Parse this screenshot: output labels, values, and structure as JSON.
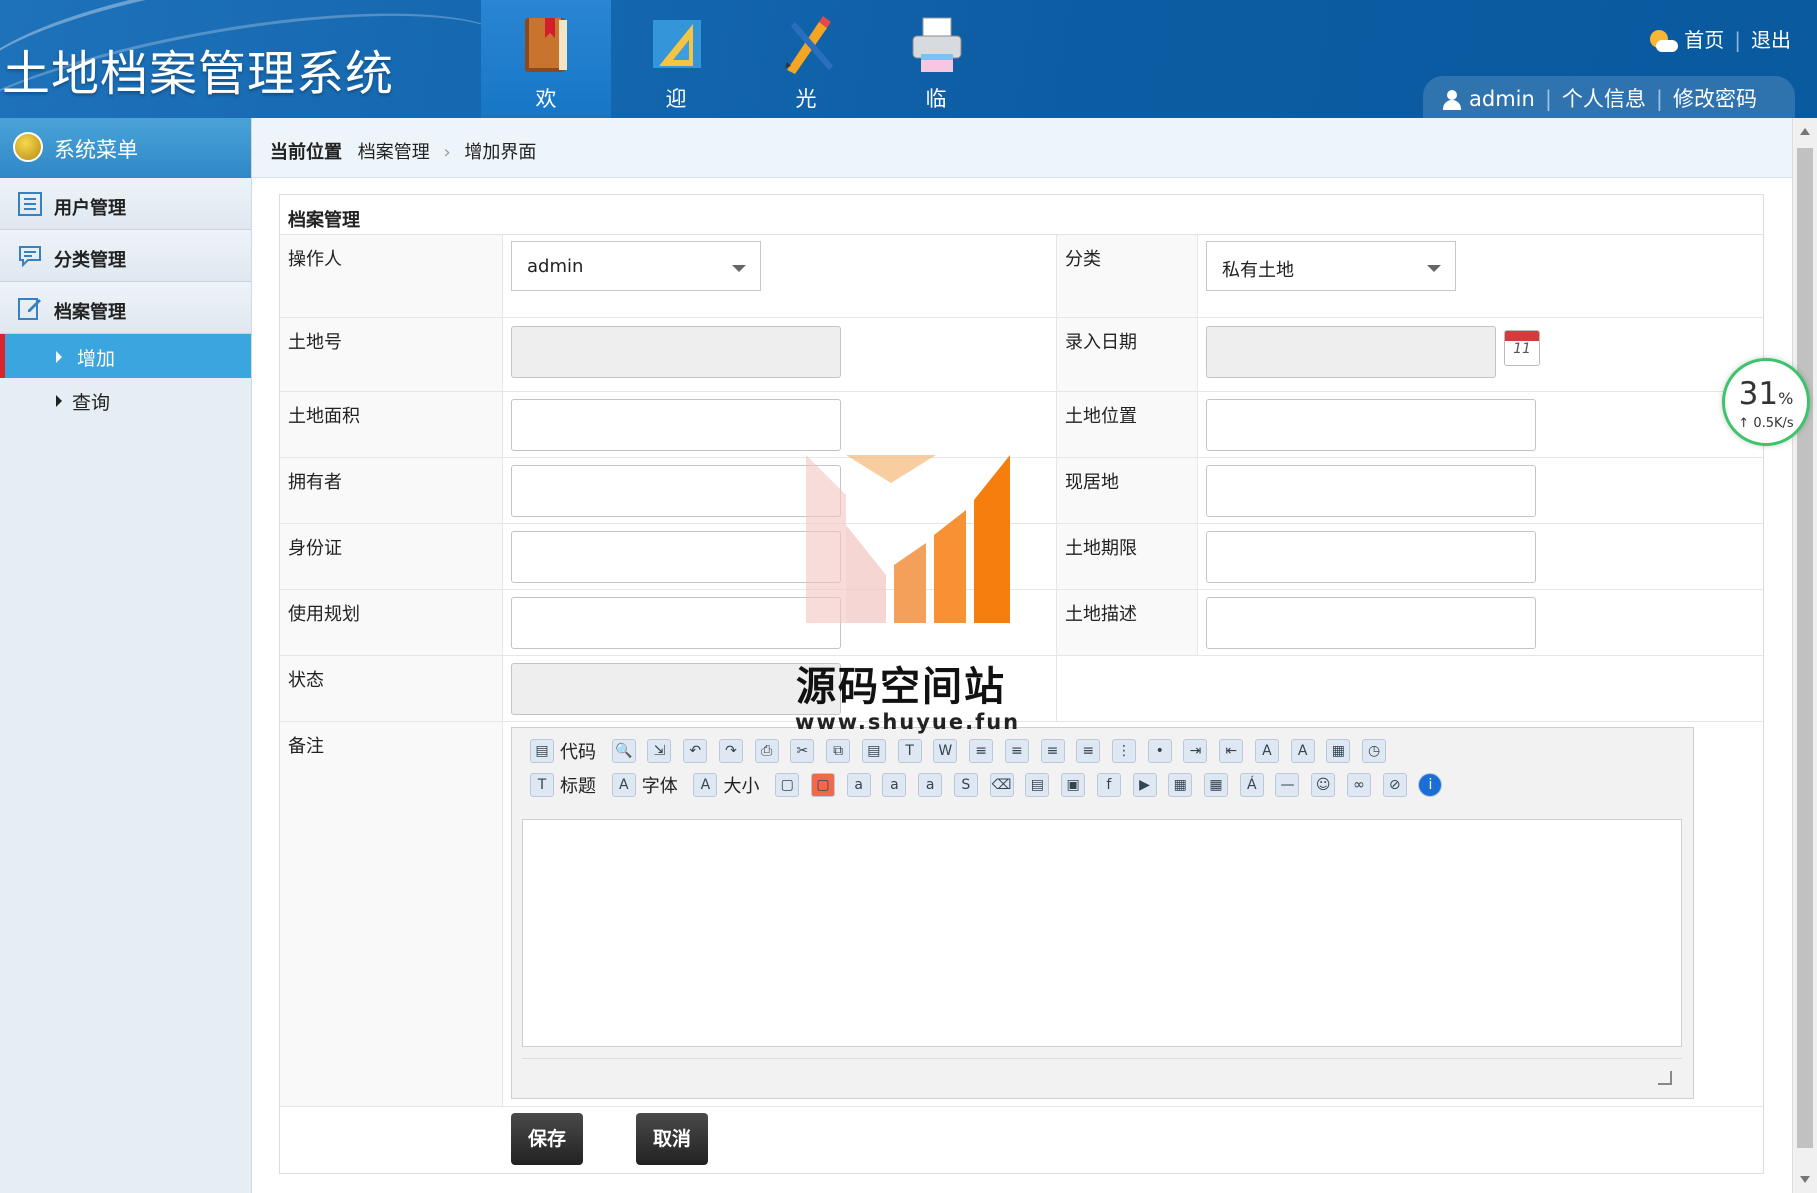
{
  "header": {
    "title": "土地档案管理系统",
    "nav": [
      {
        "label": "欢",
        "icon": "book-icon"
      },
      {
        "label": "迎",
        "icon": "ruler-icon"
      },
      {
        "label": "光",
        "icon": "pencil-icon"
      },
      {
        "label": "临",
        "icon": "printer-icon"
      }
    ],
    "links": {
      "home": "首页",
      "logout": "退出"
    },
    "user": {
      "name": "admin",
      "profile": "个人信息",
      "change_password": "修改密码"
    }
  },
  "sidebar": {
    "title": "系统菜单",
    "groups": [
      "用户管理",
      "分类管理",
      "档案管理"
    ],
    "sub_items": [
      "增加",
      "查询"
    ]
  },
  "breadcrumb": {
    "label": "当前位置",
    "items": [
      "档案管理",
      "增加界面"
    ]
  },
  "form": {
    "title": "档案管理",
    "labels": {
      "operator": "操作人",
      "category": "分类",
      "land_no": "土地号",
      "entry_date": "录入日期",
      "area": "土地面积",
      "location": "土地位置",
      "owner": "拥有者",
      "residence": "现居地",
      "id_card": "身份证",
      "term": "土地期限",
      "usage": "使用规划",
      "description": "土地描述",
      "status": "状态",
      "remarks": "备注"
    },
    "operator_value": "admin",
    "category_value": "私有土地",
    "calendar_day": "11",
    "editor": {
      "toolbar1_text": {
        "code": "代码"
      },
      "toolbar2_text": {
        "heading": "标题",
        "font": "字体",
        "size": "大小"
      }
    },
    "buttons": {
      "save": "保存",
      "cancel": "取消"
    }
  },
  "widget": {
    "percent": "31",
    "percent_sign": "%",
    "speed": "↑ 0.5K/s"
  },
  "watermark": {
    "title": "源码空间站",
    "url": "www.shuyue.fun"
  },
  "colors": {
    "header_blue": "#0c5ca3",
    "active_menu": "#3ba5e0",
    "button_dark": "#2a2a2a"
  }
}
